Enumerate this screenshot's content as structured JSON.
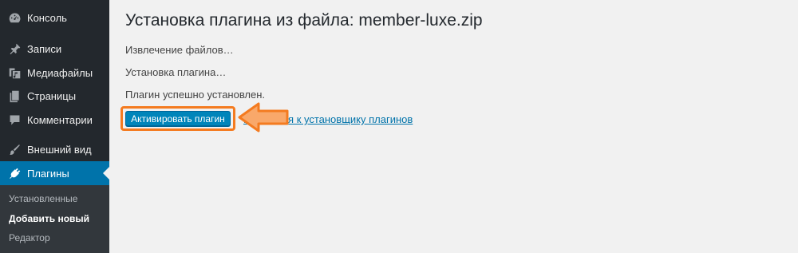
{
  "sidebar": {
    "items": [
      {
        "label": "Консоль",
        "icon": "dashboard-icon"
      },
      {
        "label": "Записи",
        "icon": "pin-icon"
      },
      {
        "label": "Медиафайлы",
        "icon": "media-icon"
      },
      {
        "label": "Страницы",
        "icon": "pages-icon"
      },
      {
        "label": "Комментарии",
        "icon": "comments-icon"
      },
      {
        "label": "Внешний вид",
        "icon": "appearance-icon"
      },
      {
        "label": "Плагины",
        "icon": "plugins-icon",
        "active": true
      }
    ],
    "submenu": [
      {
        "label": "Установленные"
      },
      {
        "label": "Добавить новый",
        "current": true
      },
      {
        "label": "Редактор"
      }
    ]
  },
  "main": {
    "title": "Установка плагина из файла: member-luxe.zip",
    "messages": [
      "Извлечение файлов…",
      "Установка плагина…",
      "Плагин успешно установлен."
    ],
    "activate_label": "Активировать плагин",
    "return_link_label": "Вернуться к установщику плагинов"
  },
  "colors": {
    "sidebar_bg": "#23282d",
    "active_bg": "#0073aa",
    "button_bg": "#0085ba",
    "highlight_orange": "#f47b20",
    "arrow_fill": "#f9a86a"
  }
}
